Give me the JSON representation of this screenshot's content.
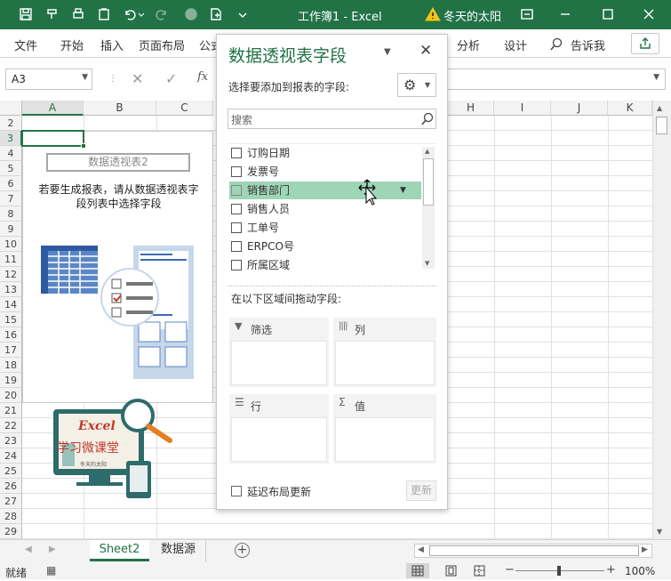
{
  "titlebar": {
    "doc_title": "工作簿1 - Excel",
    "user_name": "冬天的太阳",
    "warning_icon": "warning-icon",
    "bg_color": "#217346"
  },
  "ribbon": {
    "tabs": [
      "文件",
      "开始",
      "插入",
      "页面布局",
      "公式"
    ],
    "right_tabs": [
      "分析",
      "设计"
    ],
    "tell_me": "告诉我"
  },
  "formula_bar": {
    "name_box": "A3",
    "fx_label": "fx"
  },
  "grid": {
    "columns": [
      "A",
      "B",
      "C",
      "H",
      "I",
      "J",
      "K"
    ],
    "rows": [
      "2",
      "3",
      "4",
      "5",
      "6",
      "7",
      "8",
      "9",
      "10",
      "11",
      "12",
      "13",
      "14",
      "15",
      "16",
      "17",
      "18",
      "19",
      "20",
      "21",
      "22",
      "23",
      "24",
      "25",
      "26",
      "27",
      "28",
      "29"
    ],
    "pivot_placeholder_title": "数据透视表2",
    "pivot_placeholder_text_line1": "若要生成报表，请从数据透视表字",
    "pivot_placeholder_text_line2": "段列表中选择字段",
    "logo_text_1": "Excel",
    "logo_text_2": "学习微课堂",
    "logo_text_3": "冬天的太阳"
  },
  "pivot_pane": {
    "title": "数据透视表字段",
    "choose_label": "选择要添加到报表的字段:",
    "search_placeholder": "搜索",
    "fields": [
      {
        "label": "订购日期",
        "checked": false,
        "highlighted": false
      },
      {
        "label": "发票号",
        "checked": false,
        "highlighted": false
      },
      {
        "label": "销售部门",
        "checked": false,
        "highlighted": true
      },
      {
        "label": "销售人员",
        "checked": false,
        "highlighted": false
      },
      {
        "label": "工单号",
        "checked": false,
        "highlighted": false
      },
      {
        "label": "ERPCO号",
        "checked": false,
        "highlighted": false
      },
      {
        "label": "所属区域",
        "checked": false,
        "highlighted": false
      }
    ],
    "drag_label": "在以下区域间拖动字段:",
    "areas": {
      "filter": "筛选",
      "columns": "列",
      "rows": "行",
      "values": "值"
    },
    "defer_label": "延迟布局更新",
    "update_button": "更新",
    "highlight_color": "#9fd5b7"
  },
  "sheet_tabs": {
    "tabs": [
      "Sheet2",
      "数据源"
    ],
    "active": "Sheet2"
  },
  "status_bar": {
    "ready": "就绪",
    "zoom": "100%"
  }
}
